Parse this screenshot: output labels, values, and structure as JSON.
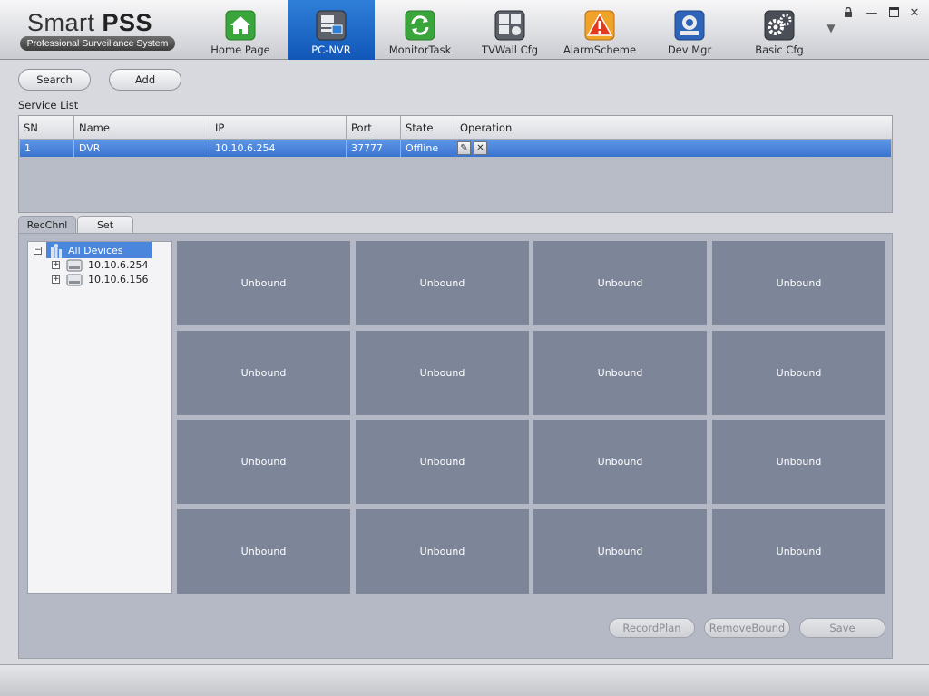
{
  "app": {
    "logo_title_light": "Smart",
    "logo_title_bold": "PSS",
    "logo_subtitle": "Professional Surveillance System"
  },
  "nav": {
    "tabs": [
      {
        "label": "Home Page",
        "icon": "home-icon",
        "color": "#3aa53a"
      },
      {
        "label": "PC-NVR",
        "icon": "pc-nvr-icon",
        "color": "#4a4f57"
      },
      {
        "label": "MonitorTask",
        "icon": "monitor-task-icon",
        "color": "#3aa53a"
      },
      {
        "label": "TVWall Cfg",
        "icon": "tvwall-icon",
        "color": "#4a4f57"
      },
      {
        "label": "AlarmScheme",
        "icon": "alarm-icon",
        "color": "#e8891c"
      },
      {
        "label": "Dev Mgr",
        "icon": "device-manager-icon",
        "color": "#2f65b8"
      },
      {
        "label": "Basic Cfg",
        "icon": "settings-gears-icon",
        "color": "#4a4f57"
      }
    ],
    "active_tab": "PC-NVR"
  },
  "toolbar": {
    "search_label": "Search",
    "add_label": "Add"
  },
  "service_list": {
    "title": "Service List",
    "columns": [
      "SN",
      "Name",
      "IP",
      "Port",
      "State",
      "Operation"
    ],
    "rows": [
      {
        "sn": "1",
        "name": "DVR",
        "ip": "10.10.6.254",
        "port": "37777",
        "state": "Offline"
      }
    ]
  },
  "panel_tabs": {
    "recchnl": "RecChnl",
    "set": "Set"
  },
  "tree": {
    "root": "All Devices",
    "devices": [
      "10.10.6.254",
      "10.10.6.156"
    ]
  },
  "grid": {
    "cell_label": "Unbound",
    "rows": 4,
    "cols": 4
  },
  "actions": {
    "record_plan": "RecordPlan",
    "remove_bound": "RemoveBound",
    "save": "Save"
  },
  "colors": {
    "accent": "#1f6fd0",
    "selected_row": "#4a86dc",
    "cell": "#7d8699"
  }
}
